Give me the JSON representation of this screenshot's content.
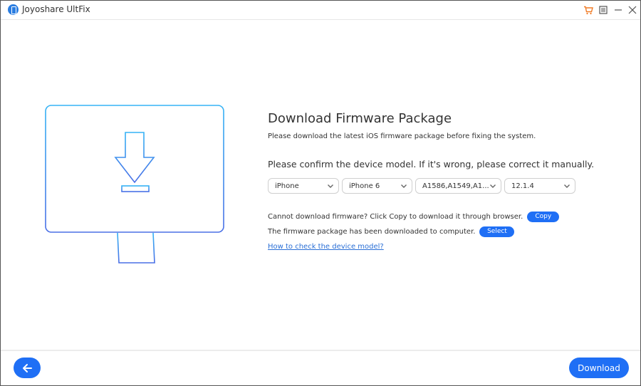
{
  "window": {
    "title": "Joyoshare UltFix",
    "controls": {
      "cart": "cart-icon",
      "menu": "menu-icon",
      "minimize": "minimize-icon",
      "close": "close-icon"
    }
  },
  "illustration": {
    "icon": "monitor-download-icon"
  },
  "main": {
    "heading": "Download Firmware Package",
    "subtext": "Please download the latest iOS firmware package before fixing the system.",
    "confirm_text": "Please confirm the device model. If it's wrong, please correct it manually.",
    "selects": [
      {
        "value": "iPhone"
      },
      {
        "value": "iPhone 6"
      },
      {
        "value": "A1586,A1549,A1..."
      },
      {
        "value": "12.1.4"
      }
    ],
    "copy_line": "Cannot download firmware? Click Copy to download it through browser.",
    "copy_label": "Copy",
    "select_line": "The firmware package has been downloaded to computer.",
    "select_label": "Select",
    "help_link": "How to check the device model?"
  },
  "footer": {
    "back_icon": "arrow-left-icon",
    "download_label": "Download"
  },
  "colors": {
    "accent": "#1f6ff5",
    "link": "#2a6fd6",
    "cart": "#f07a24"
  }
}
